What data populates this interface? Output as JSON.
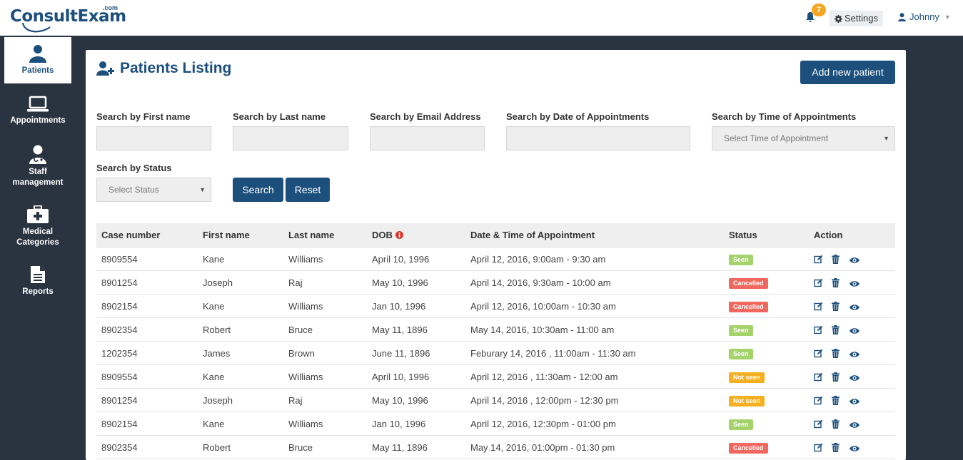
{
  "header": {
    "logo_text": "ConsultExam",
    "logo_suffix": ".com",
    "notification_count": "7",
    "settings_label": "Settings",
    "user_name": "Johnny"
  },
  "sidebar": {
    "items": [
      {
        "label": "Patients",
        "icon": "user-icon",
        "active": true
      },
      {
        "label": "Appointments",
        "icon": "laptop-icon"
      },
      {
        "label": "Staff management",
        "icon": "doctor-icon"
      },
      {
        "label": "Medical Categories",
        "icon": "medkit-icon"
      },
      {
        "label": "Reports",
        "icon": "file-icon"
      }
    ]
  },
  "page": {
    "title": "Patients Listing",
    "add_button": "Add new patient"
  },
  "filters": {
    "first_name_label": "Search by First name",
    "last_name_label": "Search by Last name",
    "email_label": "Search by Email Address",
    "date_label": "Search by Date of Appointments",
    "time_label": "Search by Time of Appointments",
    "time_placeholder": "Select Time of Appointment",
    "status_label": "Search by Status",
    "status_placeholder": "Select Status",
    "search_button": "Search",
    "reset_button": "Reset"
  },
  "table": {
    "headers": [
      "Case number",
      "First name",
      "Last name",
      "DOB",
      "Date & Time of Appointment",
      "Status",
      "Action"
    ],
    "rows": [
      {
        "case": "8909554",
        "first": "Kane",
        "last": "Williams",
        "dob": "April 10, 1996",
        "appt": "April 12, 2016, 9:00am - 9:30 am",
        "status": "Seen"
      },
      {
        "case": "8901254",
        "first": "Joseph",
        "last": "Raj",
        "dob": "May 10, 1996",
        "appt": "April 14, 2016, 9:30am - 10:00 am",
        "status": "Cancelled"
      },
      {
        "case": "8902154",
        "first": "Kane",
        "last": "Williams",
        "dob": "Jan 10, 1996",
        "appt": "April 12, 2016, 10:00am - 10:30 am",
        "status": "Cancelled"
      },
      {
        "case": "8902354",
        "first": "Robert",
        "last": "Bruce",
        "dob": "May 11, 1896",
        "appt": "May 14, 2016, 10:30am - 11:00 am",
        "status": "Seen"
      },
      {
        "case": "1202354",
        "first": "James",
        "last": "Brown",
        "dob": "June 11, 1896",
        "appt": "Feburary 14, 2016 , 11:00am - 11:30 am",
        "status": "Seen"
      },
      {
        "case": "8909554",
        "first": "Kane",
        "last": "Williams",
        "dob": "April 10, 1996",
        "appt": "April 12, 2016 , 11:30am - 12:00 am",
        "status": "Not seen"
      },
      {
        "case": "8901254",
        "first": "Joseph",
        "last": "Raj",
        "dob": "May 10, 1996",
        "appt": "April 14, 2016 , 12:00pm - 12:30 pm",
        "status": "Not seen"
      },
      {
        "case": "8902154",
        "first": "Kane",
        "last": "Williams",
        "dob": "Jan 10, 1996",
        "appt": "April 12, 2016, 12:30pm - 01:00 pm",
        "status": "Seen"
      },
      {
        "case": "8902354",
        "first": "Robert",
        "last": "Bruce",
        "dob": "May 11, 1896",
        "appt": "May 14, 2016, 01:00pm - 01:30 pm",
        "status": "Cancelled"
      }
    ]
  },
  "colors": {
    "brand": "#1c4f7c",
    "sidebar_bg": "#2a3340",
    "seen": "#a5d36b",
    "cancelled": "#f0675e",
    "not_seen": "#f5b022",
    "badge": "#f5a623"
  }
}
